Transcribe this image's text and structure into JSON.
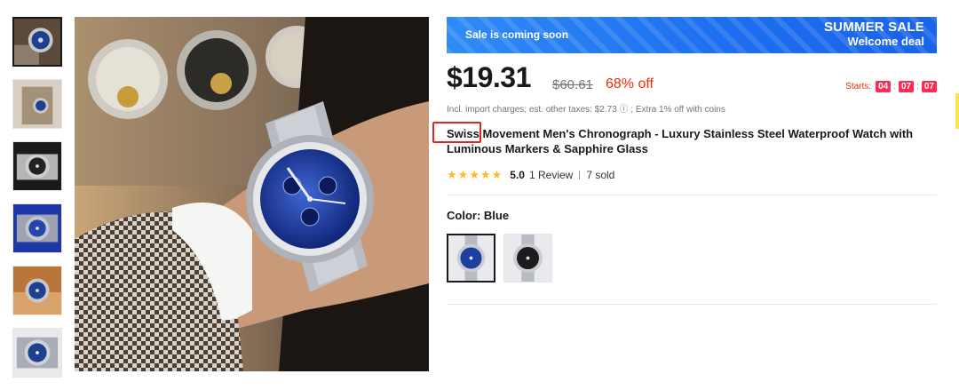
{
  "thumbnails": [
    {
      "label": "thumb-1",
      "selected": true
    },
    {
      "label": "thumb-2",
      "selected": false
    },
    {
      "label": "thumb-3",
      "selected": false
    },
    {
      "label": "thumb-4",
      "selected": false
    },
    {
      "label": "thumb-5",
      "selected": false
    },
    {
      "label": "thumb-6",
      "selected": false
    }
  ],
  "banner": {
    "left_text": "Sale is coming soon",
    "right_title": "SUMMER SALE",
    "right_subtitle": "Welcome deal",
    "bg_color": "#1d6ff0"
  },
  "price": {
    "current": "$19.31",
    "original": "$60.61",
    "discount": "68% off",
    "starts_label": "Starts:",
    "timer": [
      "04",
      "07",
      "07"
    ],
    "timer_sep": ":",
    "tax_note": "Incl. import charges; est. other taxes: $2.73 ⓘ ; Extra 1% off with coins",
    "accent_color": "#e62e04"
  },
  "product": {
    "title_highlight": "Swiss",
    "title_rest": " Movement Men's Chronograph - Luxury Stainless Steel Waterproof Watch with Luminous Markers & Sapphire Glass"
  },
  "rating": {
    "stars": 5,
    "star_icon": "star-icon",
    "value": "5.0",
    "reviews": "1 Review",
    "sold": "7 sold",
    "star_color": "#fdb92c"
  },
  "color": {
    "label": "Color:",
    "selected": "Blue",
    "options": [
      "Blue",
      "Black"
    ]
  }
}
